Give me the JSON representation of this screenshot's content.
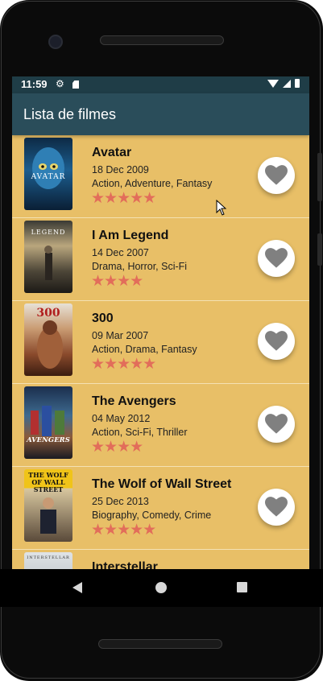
{
  "status_bar": {
    "time": "11:59"
  },
  "app_bar": {
    "title": "Lista de filmes"
  },
  "movies": [
    {
      "title": "Avatar",
      "date": "18 Dec 2009",
      "genres": "Action, Adventure, Fantasy",
      "stars": "★★★★★",
      "rating_stars": 5,
      "poster_text": "AVATAR"
    },
    {
      "title": "I Am Legend",
      "date": "14 Dec 2007",
      "genres": "Drama, Horror, Sci-Fi",
      "stars": "★★★★",
      "rating_stars": 4,
      "poster_text": "LEGEND"
    },
    {
      "title": "300",
      "date": "09 Mar 2007",
      "genres": "Action, Drama, Fantasy",
      "stars": "★★★★★",
      "rating_stars": 5,
      "poster_text": "300"
    },
    {
      "title": "The Avengers",
      "date": "04 May 2012",
      "genres": "Action, Sci-Fi, Thriller",
      "stars": "★★★★",
      "rating_stars": 4,
      "poster_text": "AVENGERS"
    },
    {
      "title": "The Wolf of Wall Street",
      "date": "25 Dec 2013",
      "genres": "Biography, Comedy, Crime",
      "stars": "★★★★★",
      "rating_stars": 5,
      "poster_text": "THE WOLF OF WALL STREET"
    },
    {
      "title": "Interstellar",
      "date": "",
      "genres": "",
      "stars": "",
      "poster_text": "INTERSTELLAR"
    }
  ],
  "colors": {
    "app_bar": "#2a4d5a",
    "status_bar": "#1f3d47",
    "list_background": "#e8bf67",
    "star": "#e26d5a",
    "heart": "#808080"
  }
}
